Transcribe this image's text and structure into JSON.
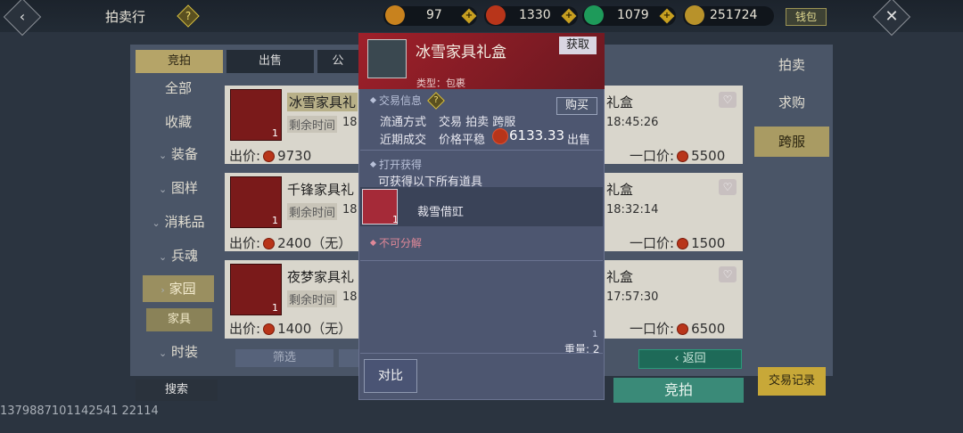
{
  "header": {
    "title": "拍卖行",
    "help_icon": "?",
    "wallet_label": "钱包",
    "currencies": [
      {
        "value": "97",
        "color": "#c8821e"
      },
      {
        "value": "1330",
        "color": "#b8351a"
      },
      {
        "value": "1079",
        "color": "#1e9a5a"
      },
      {
        "value": "251724",
        "color": "#b8922a"
      }
    ]
  },
  "tabs": [
    "竞拍",
    "出售",
    "公"
  ],
  "categories": [
    {
      "label": "全部"
    },
    {
      "label": "收藏"
    },
    {
      "label": "装备",
      "arrow": "⌄"
    },
    {
      "label": "图样",
      "arrow": "⌄"
    },
    {
      "label": "消耗品",
      "arrow": "⌄"
    },
    {
      "label": "兵魂",
      "arrow": "⌄"
    },
    {
      "label": "家园",
      "arrow": "›",
      "active": true
    },
    {
      "label": "时装",
      "arrow": "⌄"
    }
  ],
  "subcategory": "家具",
  "search_label": "搜索",
  "filter_label": "筛选",
  "back_label": "返回",
  "bid_label": "竞拍",
  "trade_record_label": "交易记录",
  "side_tabs": [
    "拍卖",
    "求购",
    "跨服"
  ],
  "footer_id": "1379887101142541 22114",
  "listings": [
    {
      "name": "冰雪家具礼",
      "remain_label": "剩余时间",
      "remain_time": "18:",
      "count": "1",
      "price_label": "出价:",
      "price": "9730",
      "price_note": "",
      "right_name": "礼盒",
      "right_time": "18:45:26",
      "buyout_label": "一口价:",
      "buyout": "5500"
    },
    {
      "name": "千锋家具礼",
      "remain_label": "剩余时间",
      "remain_time": "18:",
      "count": "1",
      "price_label": "出价:",
      "price": "2400",
      "price_note": "（无）",
      "right_name": "礼盒",
      "right_time": "18:32:14",
      "buyout_label": "一口价:",
      "buyout": "1500"
    },
    {
      "name": "夜梦家具礼",
      "remain_label": "剩余时间",
      "remain_time": "18:",
      "count": "1",
      "price_label": "出价:",
      "price": "1400",
      "price_note": "（无）",
      "right_name": "礼盒",
      "right_time": "17:57:30",
      "buyout_label": "一口价:",
      "buyout": "6500"
    }
  ],
  "popup": {
    "title": "冰雪家具礼盒",
    "obtain_label": "获取",
    "type": "类型：包裹",
    "trade_info_label": "交易信息",
    "buy_label": "购买",
    "circulation_label": "流通方式",
    "circulation_value": "交易 拍卖 跨服",
    "recent_label": "近期成交",
    "recent_value": "价格平稳",
    "recent_price": "6133.33",
    "sell_label": "出售",
    "open_label": "打开获得",
    "open_desc": "可获得以下所有道具",
    "reward_name": "裁雪借豇",
    "reward_count": "1",
    "indivisible": "不可分解",
    "small_count": "1",
    "weight": "重量: 2",
    "compare_label": "对比"
  }
}
